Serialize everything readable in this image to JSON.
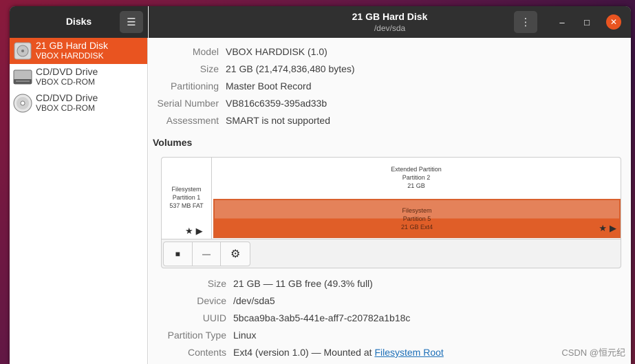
{
  "app": {
    "title": "Disks",
    "menu_icon": "hamburger-menu-icon"
  },
  "window": {
    "title": "21 GB Hard Disk",
    "subtitle": "/dev/sda",
    "more_icon": "vertical-ellipsis-icon",
    "minimize_icon": "minimize-icon",
    "maximize_icon": "maximize-icon",
    "close_icon": "close-icon",
    "accent_color": "#e95420"
  },
  "sidebar": {
    "drives": [
      {
        "name": "21 GB Hard Disk",
        "model": "VBOX HARDDISK",
        "icon": "hard-disk-icon",
        "selected": true
      },
      {
        "name": "CD/DVD Drive",
        "model": "VBOX CD-ROM",
        "icon": "optical-drive-icon",
        "selected": false
      },
      {
        "name": "CD/DVD Drive",
        "model": "VBOX CD-ROM",
        "icon": "optical-disc-icon",
        "selected": false
      }
    ]
  },
  "disk": {
    "model_label": "Model",
    "model_value": "VBOX HARDDISK (1.0)",
    "size_label": "Size",
    "size_value": "21 GB (21,474,836,480 bytes)",
    "partitioning_label": "Partitioning",
    "partitioning_value": "Master Boot Record",
    "serial_label": "Serial Number",
    "serial_value": "VB816c6359-395ad33b",
    "assessment_label": "Assessment",
    "assessment_value": "SMART is not supported"
  },
  "volumes": {
    "title": "Volumes",
    "partition1": {
      "line1": "Filesystem",
      "line2": "Partition 1",
      "line3": "537 MB FAT"
    },
    "extended": {
      "line1": "Extended Partition",
      "line2": "Partition 2",
      "line3": "21 GB"
    },
    "partition5": {
      "line1": "Filesystem",
      "line2": "Partition 5",
      "line3": "21 GB Ext4"
    },
    "badge_text": "★▶",
    "toolbar": {
      "stop_icon": "stop-icon",
      "remove_icon": "minus-icon",
      "settings_icon": "gears-icon"
    }
  },
  "selected_volume": {
    "size_label": "Size",
    "size_value": "21 GB — 11 GB free (49.3% full)",
    "device_label": "Device",
    "device_value": "/dev/sda5",
    "uuid_label": "UUID",
    "uuid_value": "5bcaa9ba-3ab5-441e-aff7-c20782a1b18c",
    "ptype_label": "Partition Type",
    "ptype_value": "Linux",
    "contents_label": "Contents",
    "contents_prefix": "Ext4 (version 1.0) — Mounted at ",
    "contents_link": "Filesystem Root"
  },
  "watermark": "CSDN @恒元纪"
}
